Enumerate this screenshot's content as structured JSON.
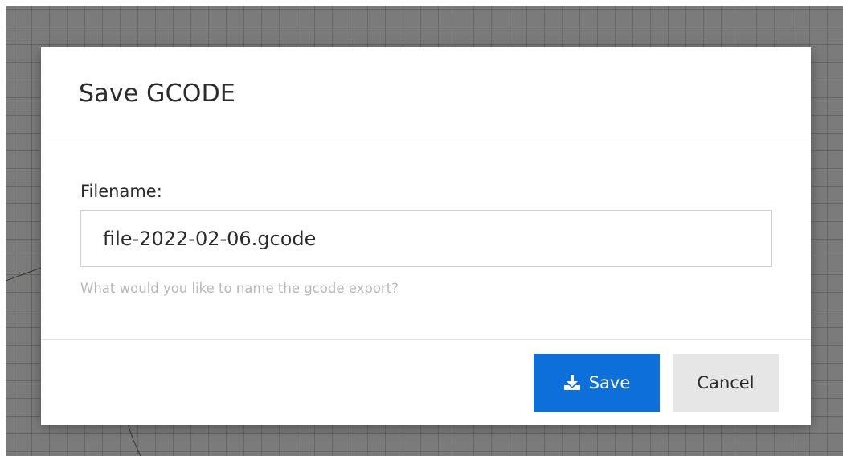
{
  "dialog": {
    "title": "Save GCODE",
    "filename_label": "Filename:",
    "filename_value": "file-2022-02-06.gcode",
    "help_text": "What would you like to name the gcode export?",
    "save_label": "Save",
    "cancel_label": "Cancel",
    "save_icon": "download-icon"
  },
  "colors": {
    "primary_button": "#0d6fd9",
    "secondary_button": "#e6e6e6",
    "backdrop": "#7b7b7b"
  }
}
